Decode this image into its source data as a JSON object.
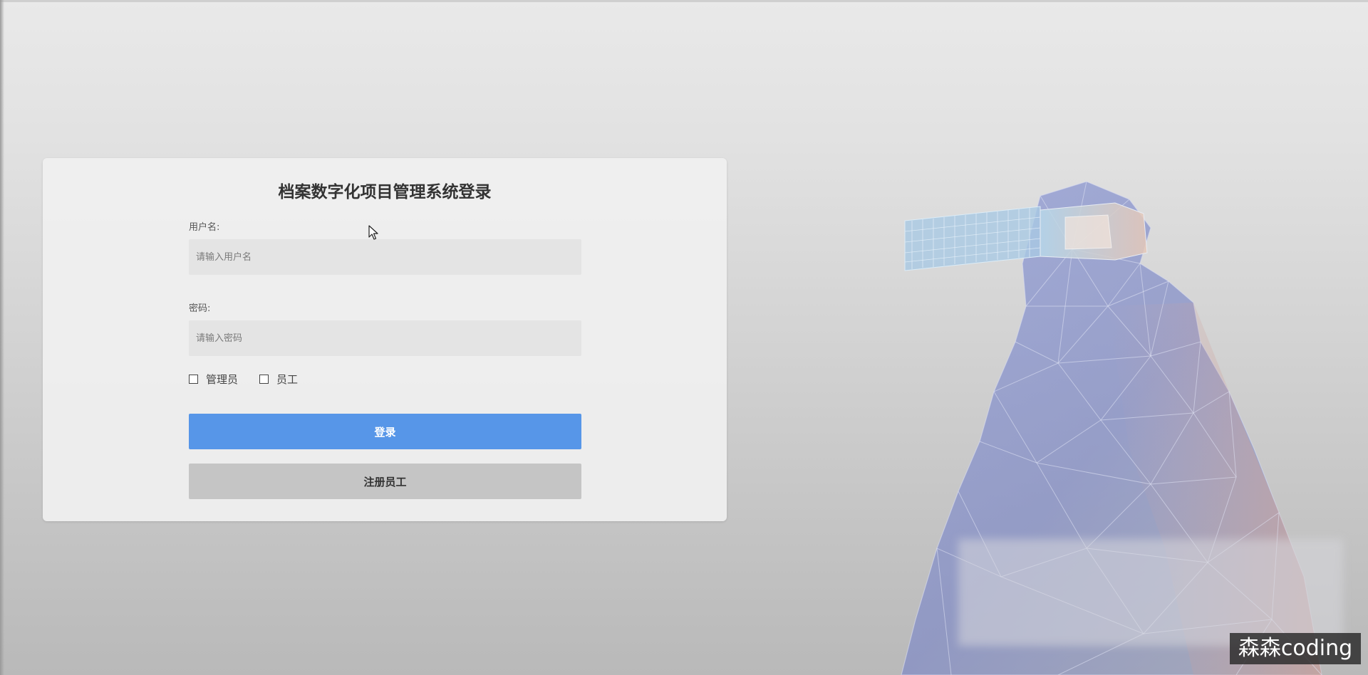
{
  "login": {
    "title": "档案数字化项目管理系统登录",
    "username_label": "用户名:",
    "username_placeholder": "请输入用户名",
    "username_value": "",
    "password_label": "密码:",
    "password_placeholder": "请输入密码",
    "password_value": "",
    "roles": [
      {
        "label": "管理员",
        "checked": false
      },
      {
        "label": "员工",
        "checked": false
      }
    ],
    "login_button": "登录",
    "register_button": "注册员工"
  },
  "watermark": "森森coding",
  "colors": {
    "primary_button": "#5796e8",
    "secondary_button": "#c5c5c5",
    "card_background": "#f0f0f0"
  },
  "icons": [
    "cursor-arrow-icon",
    "vr-lowpoly-illustration"
  ]
}
